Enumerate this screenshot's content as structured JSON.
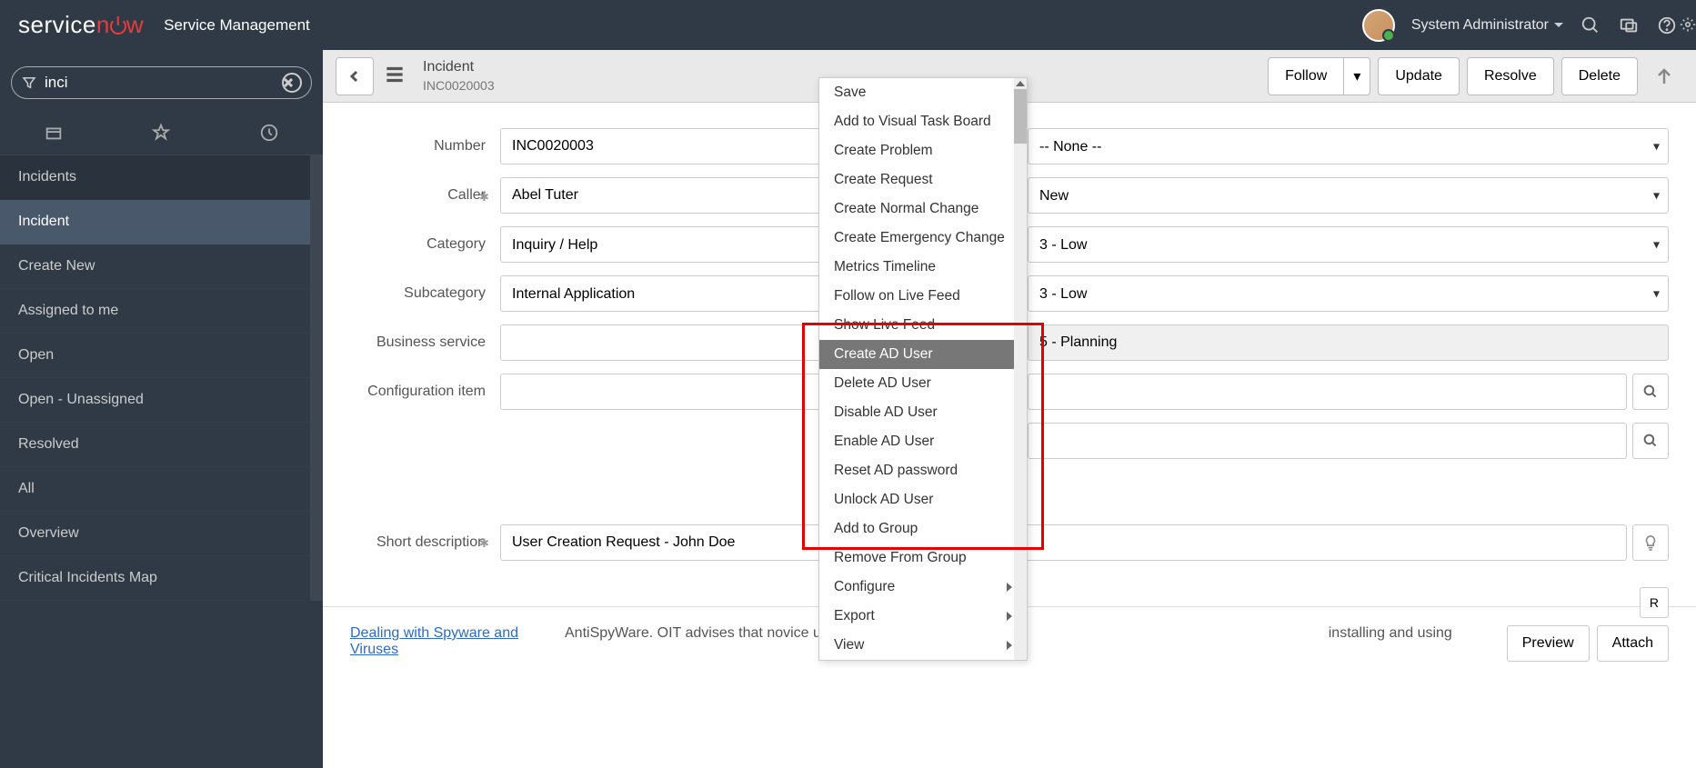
{
  "header": {
    "logo_part1": "service",
    "logo_part2": "n",
    "logo_part3": "w",
    "product": "Service Management",
    "username": "System Administrator"
  },
  "sidebar": {
    "search_value": "inci",
    "items": [
      "Incidents",
      "Incident",
      "Create New",
      "Assigned to me",
      "Open",
      "Open - Unassigned",
      "Resolved",
      "All",
      "Overview",
      "Critical Incidents Map"
    ]
  },
  "toolbar": {
    "record_type": "Incident",
    "record_number": "INC0020003",
    "follow": "Follow",
    "update": "Update",
    "resolve": "Resolve",
    "delete": "Delete"
  },
  "form": {
    "left": {
      "number_label": "Number",
      "number_value": "INC0020003",
      "caller_label": "Caller",
      "caller_value": "Abel Tuter",
      "category_label": "Category",
      "category_value": "Inquiry / Help",
      "subcategory_label": "Subcategory",
      "subcategory_value": "Internal Application",
      "business_service_label": "Business service",
      "business_service_value": "",
      "config_item_label": "Configuration item",
      "config_item_value": ""
    },
    "right": {
      "contact_type_value": "-- None --",
      "state_value": "New",
      "impact_value": "3 - Low",
      "urgency_value": "3 - Low",
      "priority_value": "5 - Planning",
      "assignment_group_value": "",
      "assigned_to_value": ""
    },
    "short_desc_label": "Short description",
    "short_desc_value": "User Creation Request - John Doe"
  },
  "related": {
    "button_partial": "R",
    "link": "Dealing with Spyware and Viruses",
    "desc": "AntiSpyWare. OIT advises that novice user",
    "desc_right": "installing and using",
    "preview": "Preview",
    "attach": "Attach"
  },
  "context_menu": {
    "items": [
      "Save",
      "Add to Visual Task Board",
      "Create Problem",
      "Create Request",
      "Create Normal Change",
      "Create Emergency Change",
      "Metrics Timeline",
      "Follow on Live Feed",
      "Show Live Feed",
      "Create AD User",
      "Delete AD User",
      "Disable AD User",
      "Enable AD User",
      "Reset AD password",
      "Unlock AD User",
      "Add to Group",
      "Remove From Group",
      "Configure",
      "Export",
      "View"
    ]
  }
}
